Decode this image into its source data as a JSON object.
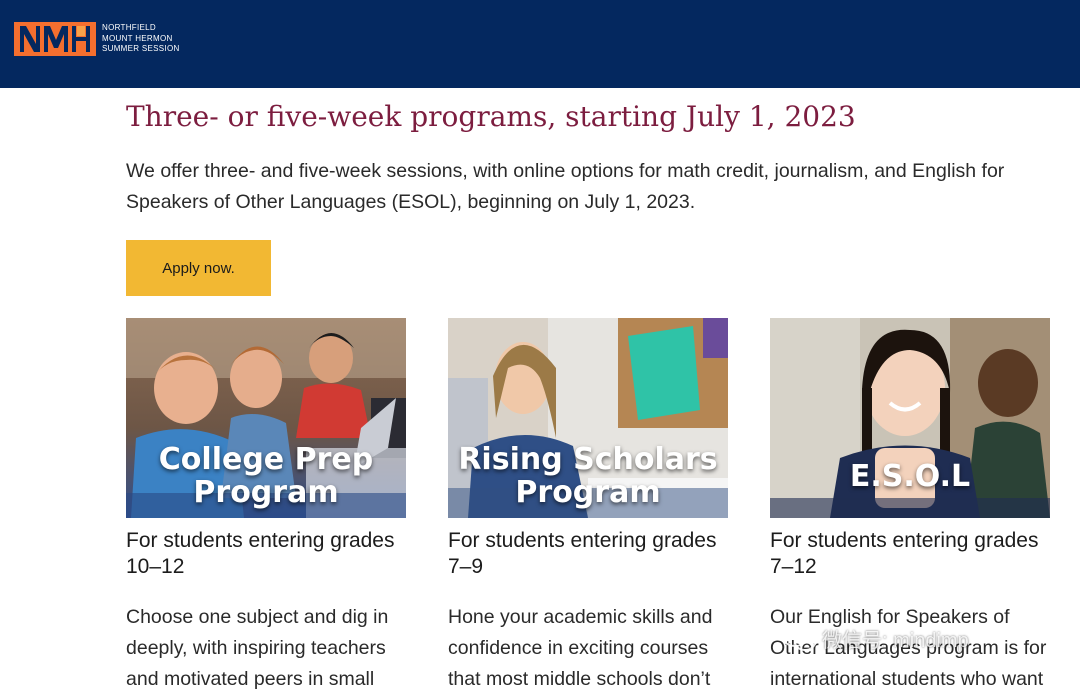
{
  "header": {
    "logo_line1": "NORTHFIELD",
    "logo_line2": "MOUNT HERMON",
    "logo_line3": "SUMMER SESSION",
    "bg_color": "#04285f",
    "logo_color": "#f46f2f"
  },
  "main": {
    "headline": "Three- or five-week programs, starting July 1, 2023",
    "intro": "We offer three- and five-week sessions, with online options for math credit, journalism, and English for Speakers of Other Languages (ESOL), beginning on July 1, 2023.",
    "apply_label": "Apply now."
  },
  "cards": [
    {
      "title_line1": "College Prep",
      "title_line2": "Program",
      "subtitle": "For students entering grades 10–12",
      "description": "Choose one subject and dig in deeply, with inspiring teachers and motivated peers in small"
    },
    {
      "title_line1": "Rising Scholars",
      "title_line2": "Program",
      "subtitle": "For students entering grades 7–9",
      "description": "Hone your academic skills and confidence in exciting courses that most middle schools don’t"
    },
    {
      "title_line1": "E.S.O.L",
      "title_line2": "",
      "subtitle": "For students entering grades 7–12",
      "description": "Our English for Speakers of Other Languages program is for international students who want"
    }
  ],
  "watermark": {
    "text": "微信号: mindimp",
    "icon": "wechat-icon"
  },
  "colors": {
    "headline": "#7c1d3f",
    "apply_button": "#f2b833"
  }
}
